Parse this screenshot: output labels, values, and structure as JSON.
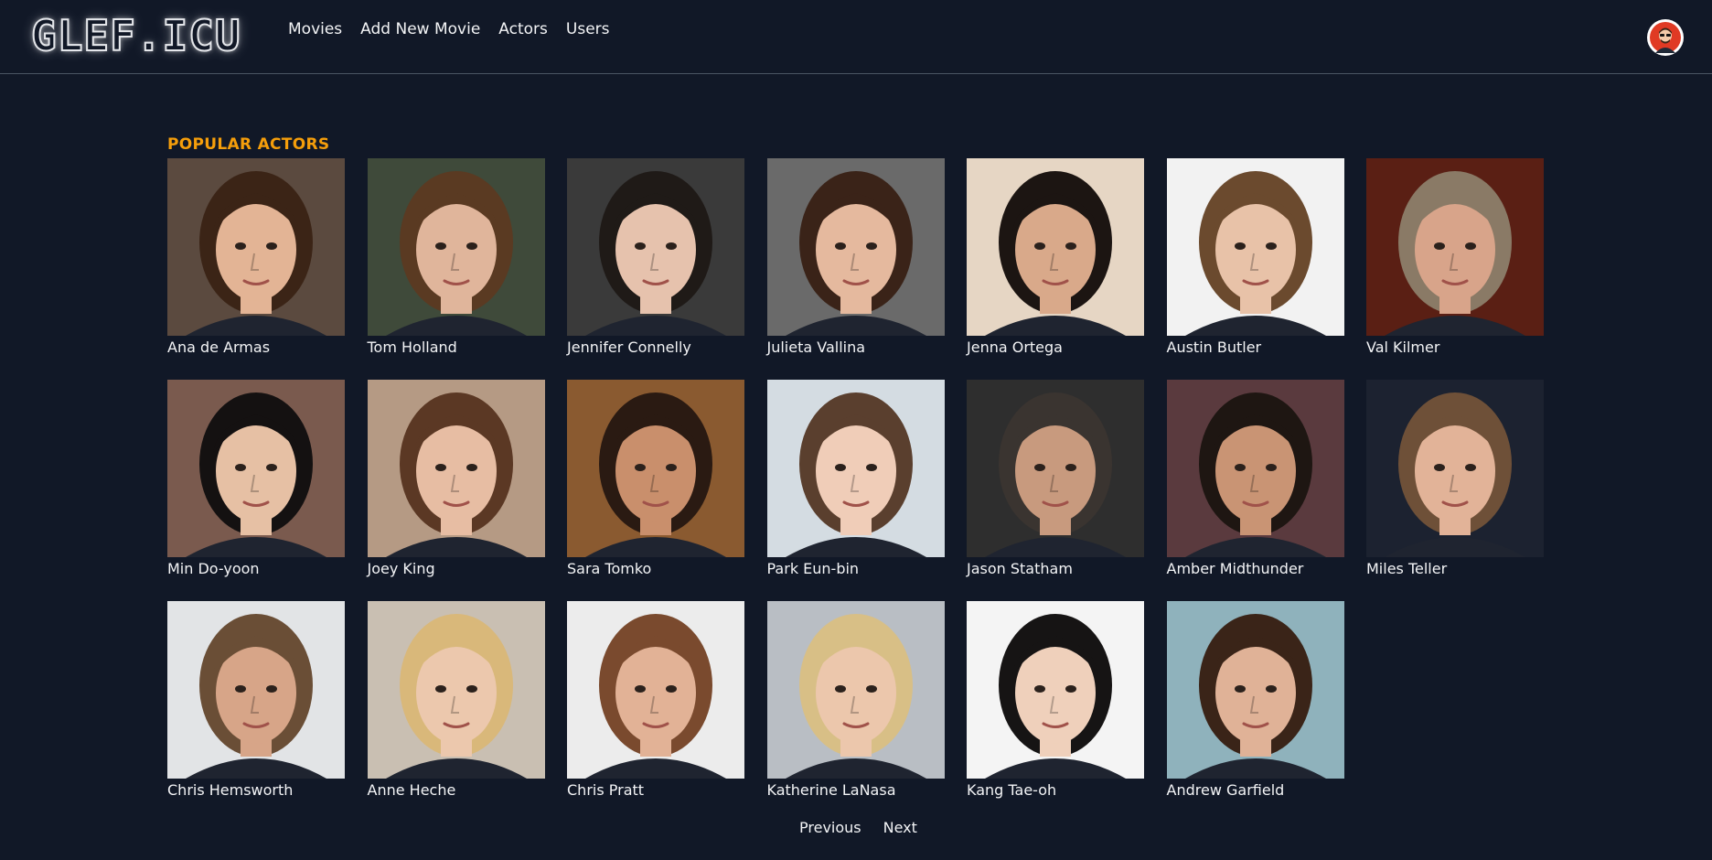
{
  "header": {
    "logo_text": "GLEF.ICU",
    "nav": [
      {
        "label": "Movies"
      },
      {
        "label": "Add New Movie"
      },
      {
        "label": "Actors"
      },
      {
        "label": "Users"
      }
    ]
  },
  "main": {
    "section_title": "POPULAR ACTORS",
    "actors": [
      {
        "name": "Ana de Armas",
        "bg": "#5b4a3f",
        "hair": "#3b2416",
        "skin": "#e3b495"
      },
      {
        "name": "Tom Holland",
        "bg": "#3f4a3a",
        "hair": "#5a3a22",
        "skin": "#e0b59b"
      },
      {
        "name": "Jennifer Connelly",
        "bg": "#3a3a3a",
        "hair": "#1f1a17",
        "skin": "#e6c2ad"
      },
      {
        "name": "Julieta Vallina",
        "bg": "#6a6a6a",
        "hair": "#3a2318",
        "skin": "#e5b99e"
      },
      {
        "name": "Jenna Ortega",
        "bg": "#e6d6c4",
        "hair": "#1c1512",
        "skin": "#d9a98a"
      },
      {
        "name": "Austin Butler",
        "bg": "#f2f2f2",
        "hair": "#6b4a2e",
        "skin": "#e8c2a8"
      },
      {
        "name": "Val Kilmer",
        "bg": "#5a1f14",
        "hair": "#8a7a66",
        "skin": "#d8a48a"
      },
      {
        "name": "Min Do-yoon",
        "bg": "#7a5a4e",
        "hair": "#141111",
        "skin": "#e6c0a4"
      },
      {
        "name": "Joey King",
        "bg": "#b59a84",
        "hair": "#5b3824",
        "skin": "#e7bda3"
      },
      {
        "name": "Sara Tomko",
        "bg": "#8a5a30",
        "hair": "#2a1a12",
        "skin": "#c98f6c"
      },
      {
        "name": "Park Eun-bin",
        "bg": "#d4dce2",
        "hair": "#5a3f2e",
        "skin": "#f0cdb8"
      },
      {
        "name": "Jason Statham",
        "bg": "#2e2e2e",
        "hair": "#3a3430",
        "skin": "#c89a7e"
      },
      {
        "name": "Amber Midthunder",
        "bg": "#5a3a3e",
        "hair": "#1e1612",
        "skin": "#c99474"
      },
      {
        "name": "Miles Teller",
        "bg": "#1c2230",
        "hair": "#6e5038",
        "skin": "#e2b398"
      },
      {
        "name": "Chris Hemsworth",
        "bg": "#e2e4e6",
        "hair": "#6a4e36",
        "skin": "#d7a588"
      },
      {
        "name": "Anne Heche",
        "bg": "#c9bfb2",
        "hair": "#d9b87a",
        "skin": "#ecc8ad"
      },
      {
        "name": "Chris Pratt",
        "bg": "#ececec",
        "hair": "#7a4a2e",
        "skin": "#e2b296"
      },
      {
        "name": "Katherine LaNasa",
        "bg": "#b9bec4",
        "hair": "#d8bf86",
        "skin": "#ecc7ac"
      },
      {
        "name": "Kang Tae-oh",
        "bg": "#f4f4f4",
        "hair": "#161414",
        "skin": "#efd0bb"
      },
      {
        "name": "Andrew Garfield",
        "bg": "#8fb2bc",
        "hair": "#3a2418",
        "skin": "#e0b297"
      }
    ]
  },
  "pagination": {
    "previous_label": "Previous",
    "next_label": "Next"
  }
}
